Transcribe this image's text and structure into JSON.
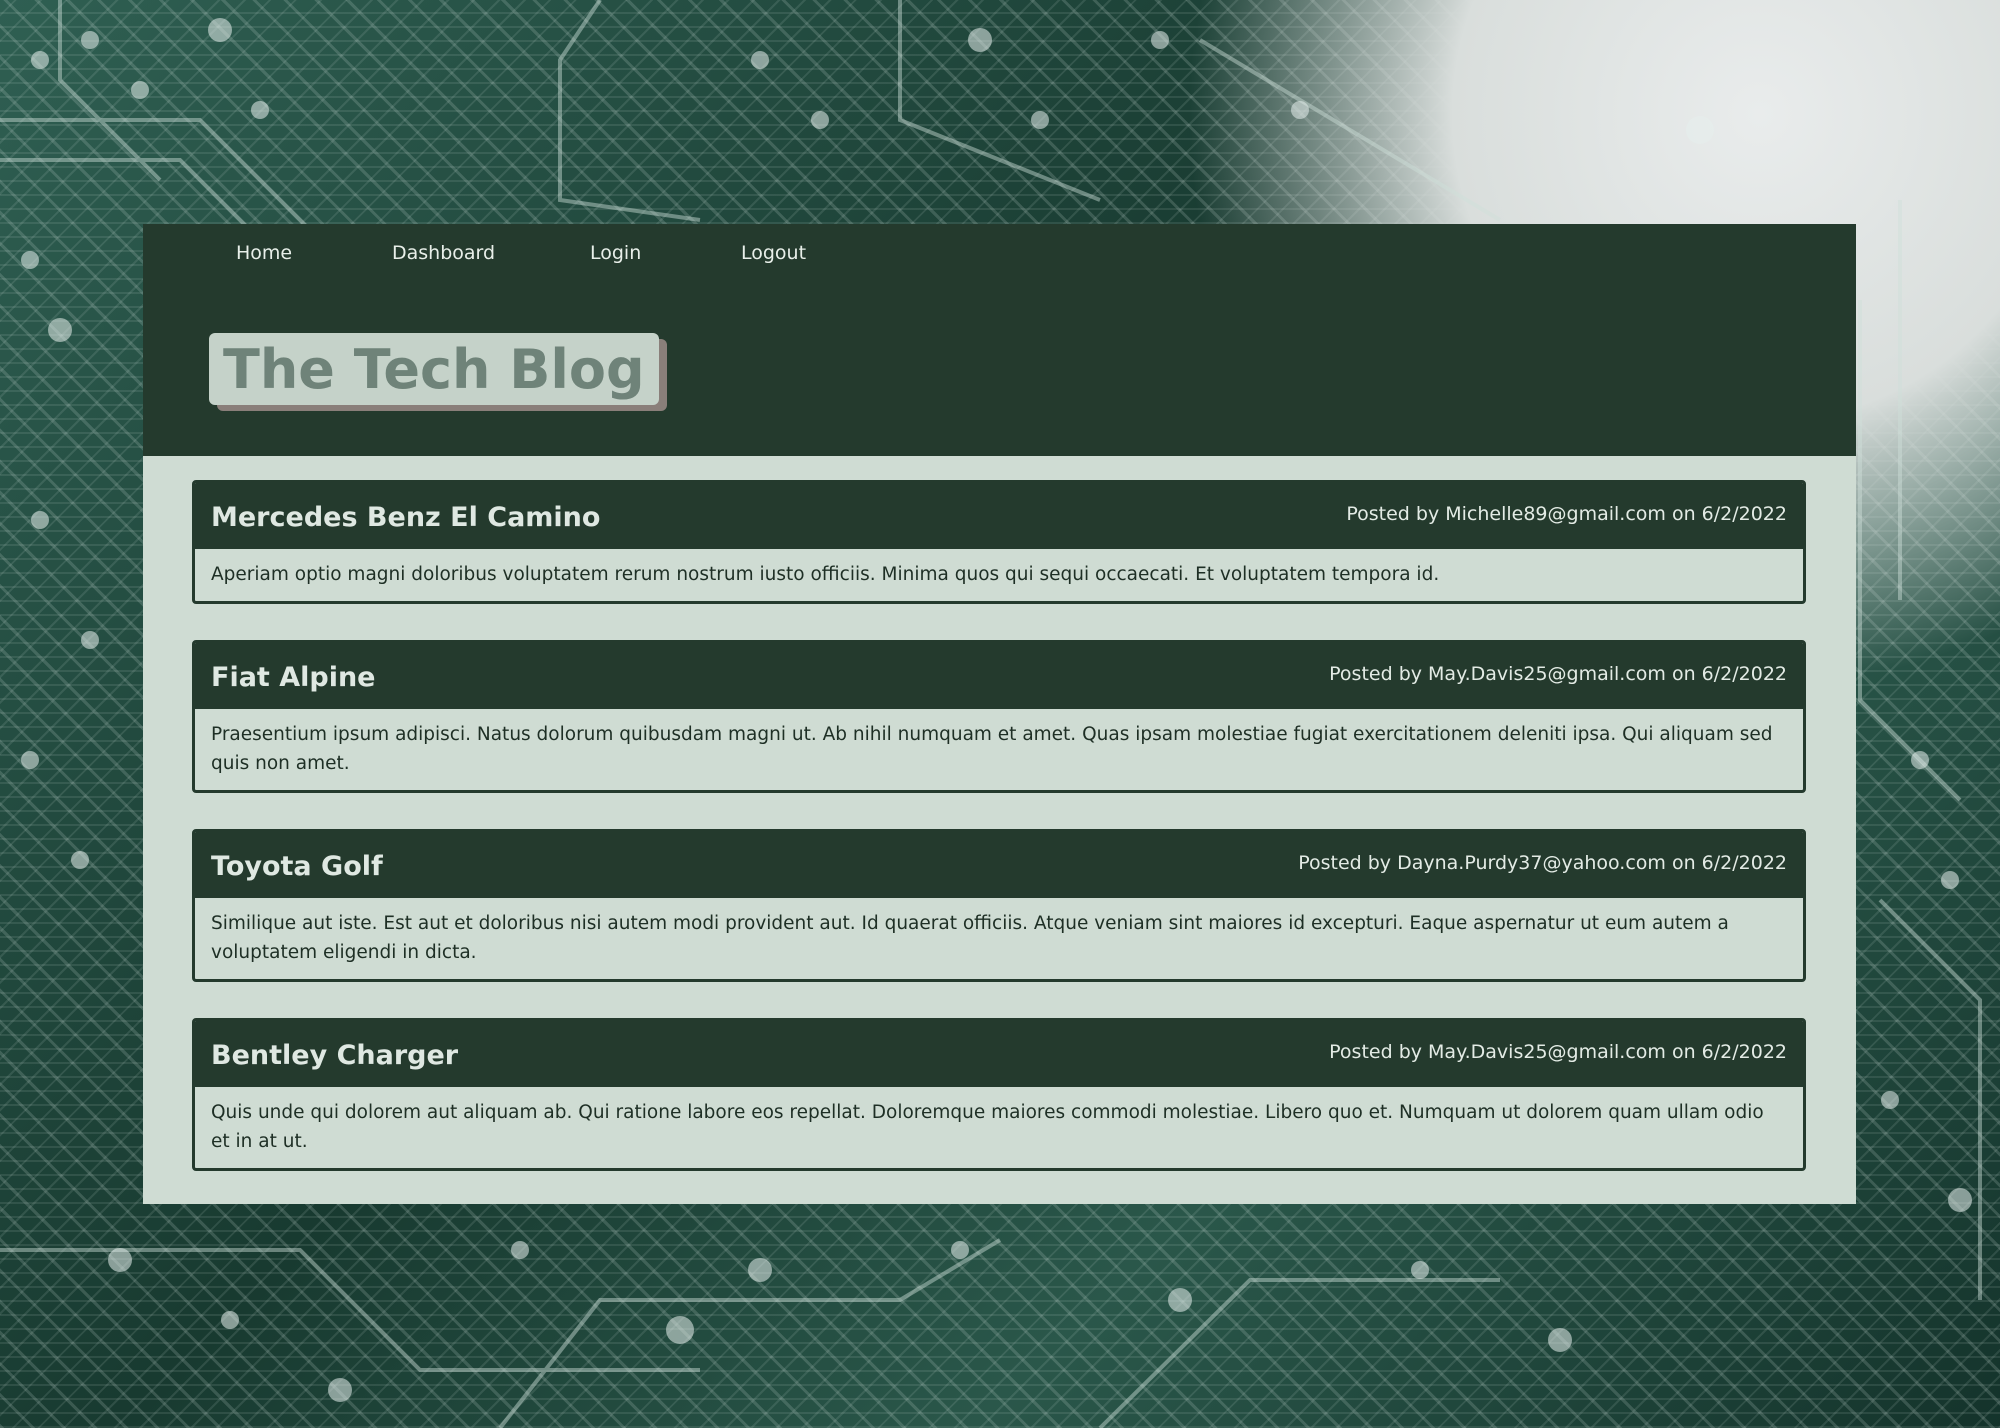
{
  "nav": {
    "items": [
      {
        "label": "Home"
      },
      {
        "label": "Dashboard"
      },
      {
        "label": "Login"
      },
      {
        "label": "Logout"
      }
    ]
  },
  "header": {
    "title": "The Tech Blog"
  },
  "posts": [
    {
      "title": "Mercedes Benz El Camino",
      "meta": "Posted by Michelle89@gmail.com on 6/2/2022",
      "body": "Aperiam optio magni doloribus voluptatem rerum nostrum iusto officiis. Minima quos qui sequi occaecati. Et voluptatem tempora id."
    },
    {
      "title": "Fiat Alpine",
      "meta": "Posted by May.Davis25@gmail.com on 6/2/2022",
      "body": "Praesentium ipsum adipisci. Natus dolorum quibusdam magni ut. Ab nihil numquam et amet. Quas ipsam molestiae fugiat exercitationem deleniti ipsa. Qui aliquam sed quis non amet."
    },
    {
      "title": "Toyota Golf",
      "meta": "Posted by Dayna.Purdy37@yahoo.com on 6/2/2022",
      "body": "Similique aut iste. Est aut et doloribus nisi autem modi provident aut. Id quaerat officiis. Atque veniam sint maiores id excepturi. Eaque aspernatur ut eum autem a voluptatem eligendi in dicta."
    },
    {
      "title": "Bentley Charger",
      "meta": "Posted by May.Davis25@gmail.com on 6/2/2022",
      "body": "Quis unde qui dolorem aut aliquam ab. Qui ratione labore eos repellat. Doloremque maiores commodi molestiae. Libero quo et. Numquam ut dolorem quam ullam odio et in at ut."
    }
  ],
  "colors": {
    "header_bg": "#243a2d",
    "content_bg": "#cfdcd3",
    "title_box_bg": "#c5d2c9",
    "title_text": "#6f8379"
  }
}
